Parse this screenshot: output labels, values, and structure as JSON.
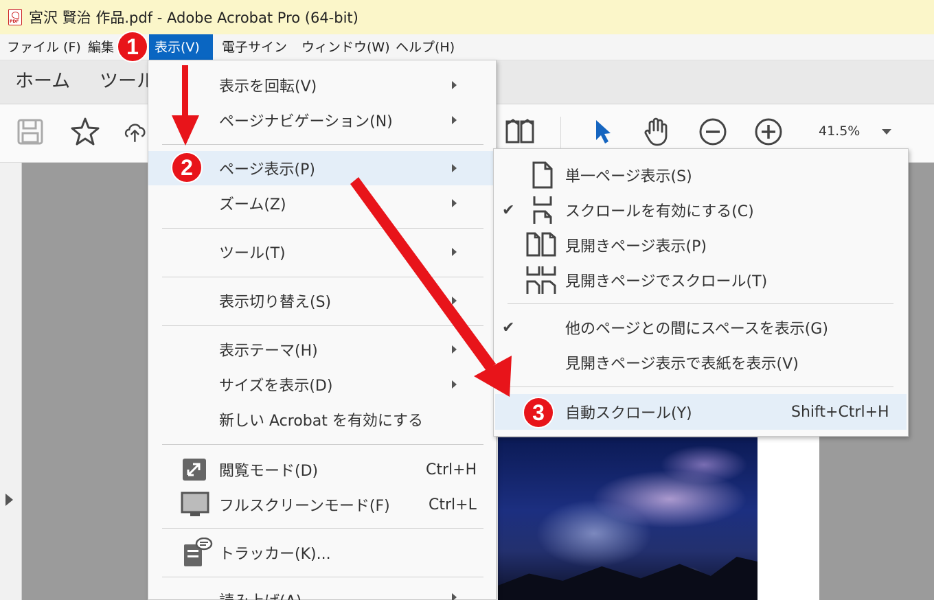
{
  "window": {
    "title": "宮沢 賢治 作品.pdf - Adobe Acrobat Pro (64-bit)"
  },
  "menubar": {
    "items": [
      "ファイル (F)",
      "編集",
      "表示(V)",
      "電子サイン",
      "ウィンドウ(W)",
      "ヘルプ(H)"
    ]
  },
  "tabs": [
    "ホーム",
    "ツール"
  ],
  "toolbar": {
    "zoom": "41.5%"
  },
  "view_menu": {
    "items": [
      {
        "label": "表示を回転(V)",
        "submenu": true
      },
      {
        "label": "ページナビゲーション(N)",
        "submenu": true
      },
      {
        "label": "ページ表示(P)",
        "submenu": true,
        "highlighted": true
      },
      {
        "label": "ズーム(Z)",
        "submenu": true
      },
      {
        "label": "ツール(T)",
        "submenu": true
      },
      {
        "label": "表示切り替え(S)",
        "submenu": true
      },
      {
        "label": "表示テーマ(H)",
        "submenu": true
      },
      {
        "label": "サイズを表示(D)",
        "submenu": true
      },
      {
        "label": "新しい Acrobat を有効にする"
      },
      {
        "label": "閲覧モード(D)",
        "shortcut": "Ctrl+H",
        "icon": "reading-mode-icon"
      },
      {
        "label": "フルスクリーンモード(F)",
        "shortcut": "Ctrl+L",
        "icon": "fullscreen-icon"
      },
      {
        "label": "トラッカー(K)...",
        "icon": "tracker-icon"
      },
      {
        "label": "読み上げ(A)",
        "submenu": true
      }
    ]
  },
  "page_display_submenu": {
    "items": [
      {
        "label": "単一ページ表示(S)",
        "icon": "single-page-icon"
      },
      {
        "label": "スクロールを有効にする(C)",
        "icon": "scrolling-icon",
        "checked": true
      },
      {
        "label": "見開きページ表示(P)",
        "icon": "two-page-icon"
      },
      {
        "label": "見開きページでスクロール(T)",
        "icon": "two-page-scroll-icon"
      },
      {
        "label": "他のページとの間にスペースを表示(G)",
        "checked": true
      },
      {
        "label": "見開きページ表示で表紙を表示(V)"
      },
      {
        "label": "自動スクロール(Y)",
        "shortcut": "Shift+Ctrl+H",
        "highlighted": true
      }
    ]
  },
  "annotations": {
    "step1": "1",
    "step2": "2",
    "step3": "3"
  },
  "colors": {
    "accent": "#0a66c2",
    "badge": "#e8141a",
    "highlight": "#e4eef8"
  }
}
